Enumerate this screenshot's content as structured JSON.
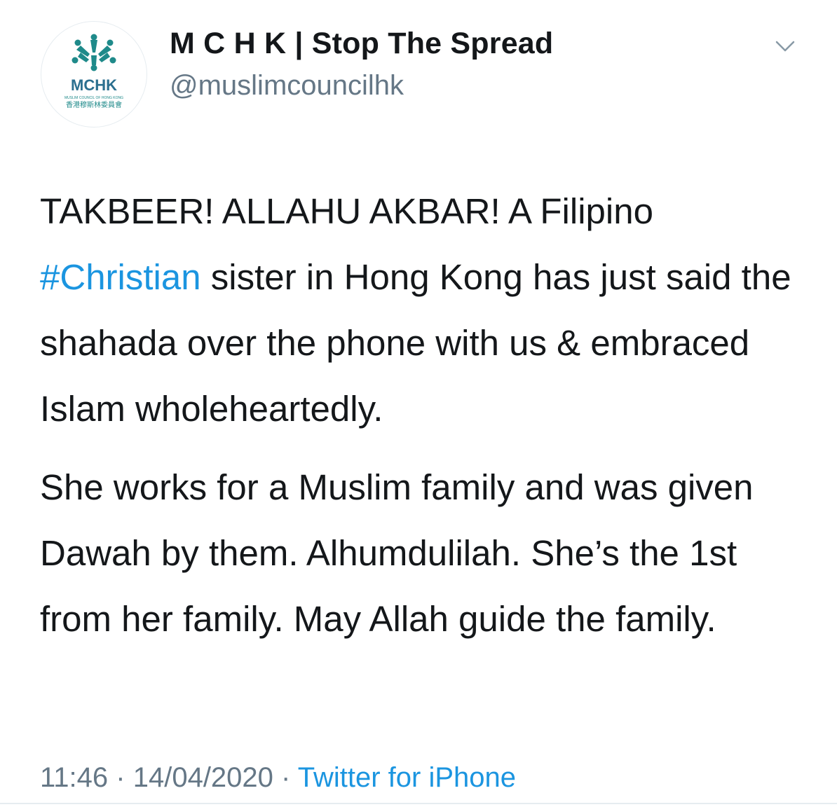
{
  "tweet": {
    "author": {
      "name": "M C H K | Stop The Spread",
      "handle": "@muslimcouncilhk",
      "avatar": {
        "logo_text": "MCHK",
        "logo_subtext": "MUSLIM COUNCIL OF HONG KONG",
        "logo_chinese": "香港穆斯林委員會",
        "accent_color": "#1f8a8a"
      }
    },
    "menu_icon": "chevron-down-icon",
    "paragraphs": [
      {
        "before": "TAKBEER! ALLAHU AKBAR! A Filipino ",
        "hashtag": "#Christian",
        "after": " sister in Hong Kong has just said the shahada over the phone with us & embraced Islam wholeheartedly."
      },
      {
        "text": "She works for a Muslim family and was given Dawah by them. Alhumdulilah. She’s the 1st from her family. May Allah guide the family."
      }
    ],
    "time": "11:46",
    "separator": "·",
    "date": "14/04/2020",
    "source": "Twitter for iPhone"
  },
  "colors": {
    "text": "#14171a",
    "secondary": "#657786",
    "link": "#1b95e0",
    "divider": "#e6ecf0"
  }
}
